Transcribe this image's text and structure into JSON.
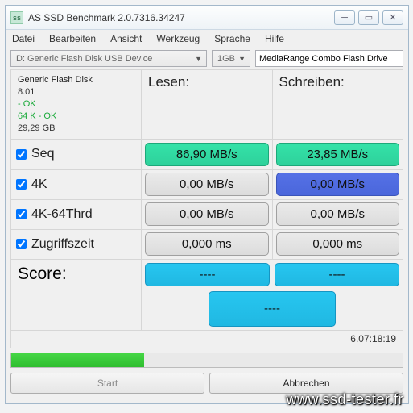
{
  "window": {
    "title": "AS SSD Benchmark 2.0.7316.34247"
  },
  "menu": {
    "file": "Datei",
    "edit": "Bearbeiten",
    "view": "Ansicht",
    "tool": "Werkzeug",
    "lang": "Sprache",
    "help": "Hilfe"
  },
  "toolbar": {
    "device": "D: Generic Flash Disk USB Device",
    "size": "1GB",
    "product": "MediaRange Combo Flash Drive"
  },
  "info": {
    "name": "Generic Flash Disk",
    "fw": "8.01",
    "align": " - OK",
    "driver": "64 K - OK",
    "capacity": "29,29 GB"
  },
  "headers": {
    "read": "Lesen:",
    "write": "Schreiben:"
  },
  "rows": {
    "seq": {
      "label": "Seq",
      "read": "86,90 MB/s",
      "write": "23,85 MB/s"
    },
    "k4": {
      "label": "4K",
      "read": "0,00 MB/s",
      "write": "0,00 MB/s"
    },
    "k64": {
      "label": "4K-64Thrd",
      "read": "0,00 MB/s",
      "write": "0,00 MB/s"
    },
    "acc": {
      "label": "Zugriffszeit",
      "read": "0,000 ms",
      "write": "0,000 ms"
    }
  },
  "score": {
    "label": "Score:",
    "read": "----",
    "write": "----",
    "total": "----"
  },
  "timer": "6.07:18:19",
  "buttons": {
    "start": "Start",
    "abort": "Abbrechen"
  },
  "watermark": "www.ssd-tester.fr"
}
